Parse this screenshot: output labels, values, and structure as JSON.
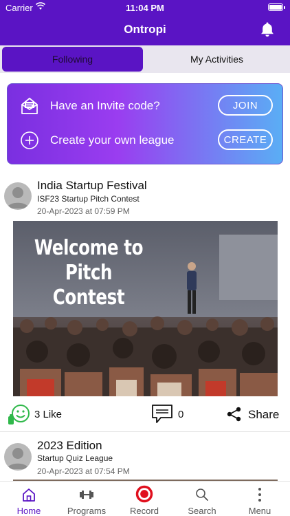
{
  "status_bar": {
    "carrier": "Carrier",
    "time": "11:04 PM"
  },
  "header": {
    "title": "Ontropi",
    "notification_icon": "bell-icon"
  },
  "tabs": [
    {
      "label": "Following",
      "active": true
    },
    {
      "label": "My Activities",
      "active": false
    }
  ],
  "invite_card": {
    "invite_text": "Have an Invite code?",
    "join_label": "JOIN",
    "create_text": "Create your own league",
    "create_label": "CREATE"
  },
  "posts": [
    {
      "title": "India Startup Festival",
      "subtitle": "ISF23 Startup Pitch Contest",
      "date": "20-Apr-2023 at 07:59 PM",
      "image_text_line1": "Welcome to",
      "image_text_line2": "Pitch Contest",
      "likes": "3 Like",
      "comments": "0",
      "share_label": "Share"
    },
    {
      "title": "2023 Edition",
      "subtitle": "Startup Quiz League",
      "date": "20-Apr-2023 at 07:54 PM"
    }
  ],
  "bottom_nav": [
    {
      "label": "Home",
      "icon": "home-icon",
      "active": true
    },
    {
      "label": "Programs",
      "icon": "dumbbell-icon",
      "active": false
    },
    {
      "label": "Record",
      "icon": "record-icon",
      "active": false
    },
    {
      "label": "Search",
      "icon": "search-icon",
      "active": false
    },
    {
      "label": "Menu",
      "icon": "more-vertical-icon",
      "active": false
    }
  ],
  "colors": {
    "brand": "#5a14c4",
    "card_gradient_start": "#7a2fe0",
    "card_gradient_end": "#5aaef5",
    "like_green": "#2fb84a",
    "record_red": "#e0101e"
  }
}
